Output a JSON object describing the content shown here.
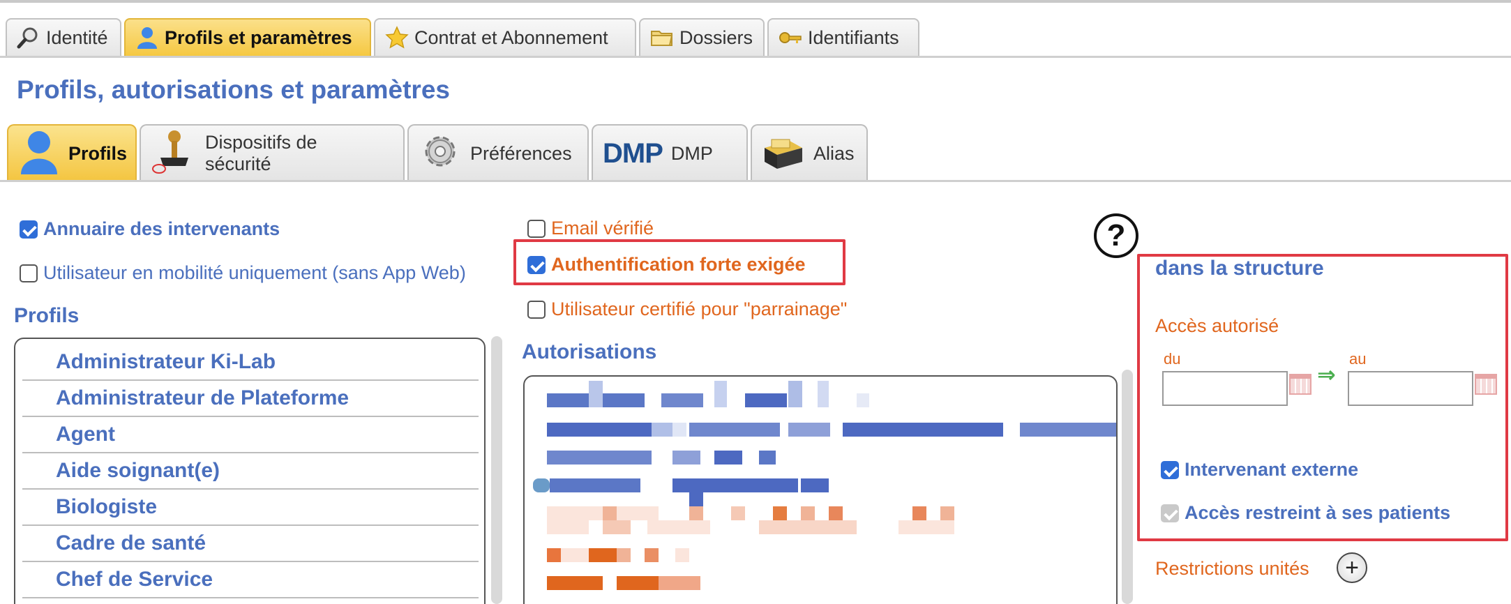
{
  "top_tabs": [
    {
      "label": "Identité",
      "icon": "magnifier-icon"
    },
    {
      "label": "Profils et paramètres",
      "icon": "user-icon",
      "active": true
    },
    {
      "label": "Contrat et Abonnement",
      "icon": "star-icon"
    },
    {
      "label": "Dossiers",
      "icon": "folder-icon"
    },
    {
      "label": "Identifiants",
      "icon": "key-icon"
    }
  ],
  "page_title": "Profils, autorisations et paramètres",
  "sub_tabs": [
    {
      "label": "Profils",
      "icon": "user-icon",
      "active": true
    },
    {
      "label": "Dispositifs de sécurité",
      "icon": "stamp-icon"
    },
    {
      "label": "Préférences",
      "icon": "gear-icon"
    },
    {
      "label": "DMP",
      "icon": "dmp-logo-icon",
      "logo_text": "DMP"
    },
    {
      "label": "Alias",
      "icon": "cardbox-icon"
    }
  ],
  "left": {
    "annuaire_label": "Annuaire des intervenants",
    "annuaire_checked": true,
    "mobilite_label": "Utilisateur en mobilité uniquement (sans App Web)",
    "mobilite_checked": false,
    "profiles_heading": "Profils",
    "profiles": [
      "Administrateur Ki-Lab",
      "Administrateur de Plateforme",
      "Agent",
      "Aide soignant(e)",
      "Biologiste",
      "Cadre de santé",
      "Chef de Service"
    ]
  },
  "middle": {
    "email_label": "Email vérifié",
    "email_checked": false,
    "auth_label": "Authentification forte exigée",
    "auth_checked": true,
    "certifie_label": "Utilisateur certifié pour \"parrainage\"",
    "certifie_checked": false,
    "autorisations_heading": "Autorisations"
  },
  "right": {
    "help_symbol": "?",
    "structure_heading": "dans la structure",
    "acces_label": "Accès autorisé",
    "du_label": "du",
    "au_label": "au",
    "du_value": "",
    "au_value": "",
    "arrow_symbol": "⇒",
    "intervenant_label": "Intervenant externe",
    "intervenant_checked": true,
    "restreint_label": "Accès restreint à ses patients",
    "restreint_checked": true,
    "restrictions_label": "Restrictions unités",
    "plus_symbol": "+"
  },
  "colors": {
    "accent_blue": "#4a6fbd",
    "accent_orange": "#e0661e",
    "highlight_red": "#e03a44",
    "active_tab": "#f5c842"
  }
}
